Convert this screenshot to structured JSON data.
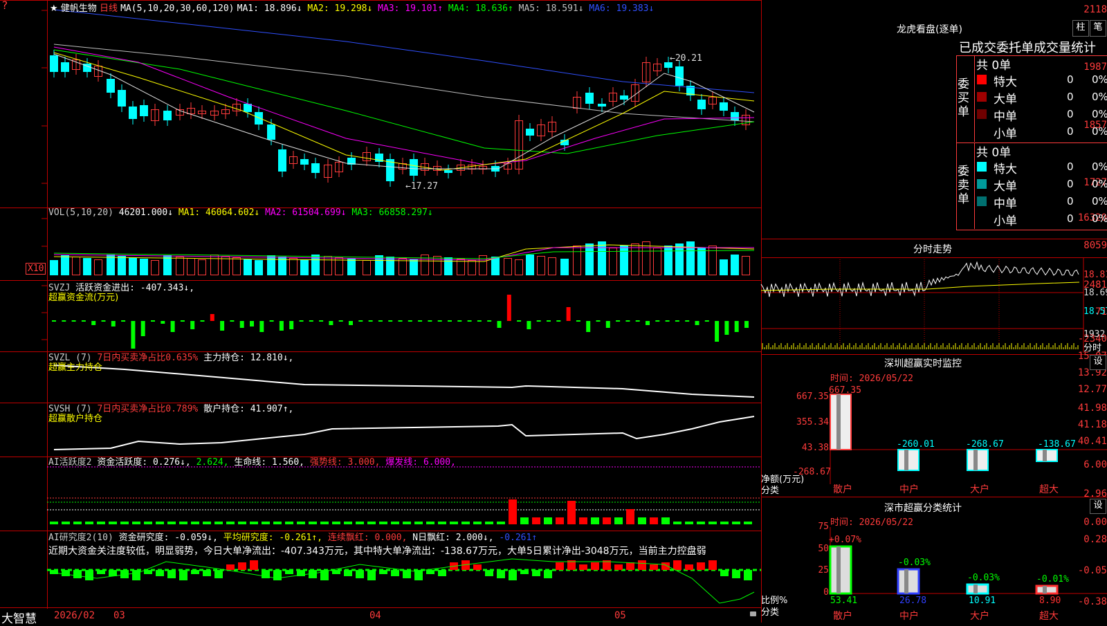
{
  "main": {
    "stock_name": "健帆生物",
    "period": "日线",
    "ma_header": "MA(5,10,20,30,60,120)",
    "ma_items": [
      {
        "label": "MA1: 18.896↓",
        "color": "#ffffff"
      },
      {
        "label": "MA2: 19.298↓",
        "color": "#ffff00"
      },
      {
        "label": "MA3: 19.101↑",
        "color": "#ff00ff"
      },
      {
        "label": "MA4: 18.636↑",
        "color": "#00ff00"
      },
      {
        "label": "MA5: 18.591↓",
        "color": "#c0c0c0"
      },
      {
        "label": "MA6: 19.383↓",
        "color": "#3050ff"
      }
    ],
    "y_labels": [
      "2118",
      "1987",
      "1857",
      "1727"
    ],
    "high_mark": "20.21",
    "low_mark": "17.27",
    "marker": "★"
  },
  "vol": {
    "title": "VOL(5,10,20)",
    "value": "46201.000↓",
    "items": [
      {
        "label": "MA1: 46064.602↓",
        "color": "#ffff00"
      },
      {
        "label": "MA2: 61504.699↓",
        "color": "#ff00ff"
      },
      {
        "label": "MA3: 66858.297↓",
        "color": "#00ff00"
      }
    ],
    "y_labels": [
      "16320",
      "8059"
    ],
    "unit": "X10"
  },
  "svzj": {
    "title": "SVZJ",
    "text": "活跃资金进出: -407.343↓,",
    "sub": "超赢资金流(万元)",
    "y_labels": [
      "2481",
      "71",
      "-2340"
    ]
  },
  "svzl": {
    "title": "SVZL (7)",
    "red_text": "7日内买卖净占比0.635%",
    "text": "主力持仓: 12.810↓,",
    "sub": "超赢主力持仓",
    "y_labels": [
      "15.07",
      "13.92",
      "12.77"
    ]
  },
  "svsh": {
    "title": "SVSH (7)",
    "red_text": "7日内买卖净占比0.789%",
    "text": "散户持仓: 41.907↑,",
    "sub": "超赢散户持仓",
    "y_labels": [
      "41.98",
      "41.18",
      "40.41"
    ]
  },
  "ai1": {
    "title": "AI活跃度2",
    "items": [
      {
        "label": "资金活跃度: 0.276↓,",
        "color": "#ffffff"
      },
      {
        "label": "2.624,",
        "color": "#00ff00"
      },
      {
        "label": "生命线: 1.560,",
        "color": "#ffffff"
      },
      {
        "label": "强势线: 3.000,",
        "color": "#ff3b3b"
      },
      {
        "label": "爆发线: 6.000,",
        "color": "#ff00ff"
      }
    ],
    "y_labels": [
      "6.00",
      "2.96",
      "0.00"
    ]
  },
  "ai2": {
    "title": "AI研究度2(10)",
    "items": [
      {
        "label": "资金研究度: -0.059↓,",
        "color": "#ffffff"
      },
      {
        "label": "平均研究度: -0.261↑,",
        "color": "#ffff00"
      },
      {
        "label": "连续飘红: 0.000,",
        "color": "#ff3b3b"
      },
      {
        "label": "N日飘红: 2.000↓,",
        "color": "#ffffff"
      },
      {
        "label": "-0.261↑",
        "color": "#3050ff"
      }
    ],
    "comment": "近期大资金关注度较低，明显弱势，今日大单净流出：-407.343万元，其中特大单净流出：-138.67万元，大单5日累计净出-3048万元，当前主力控盘弱",
    "y_labels": [
      "0.28",
      "-0.05",
      "-0.38"
    ]
  },
  "axis": {
    "brand": "大智慧",
    "labels": [
      "2026/02",
      "03",
      "04",
      "05"
    ]
  },
  "longhu": {
    "title": "龙虎看盘(逐单)",
    "btn_zhu": "柱",
    "btn_bi": "笔",
    "header": "已成交委托单成交量统计",
    "buy_label": "委买单",
    "sell_label": "委卖单",
    "buy_total": "共 0单",
    "sell_total": "共 0单",
    "buy_rows": [
      {
        "name": "特大",
        "count": "0",
        "pct": "0%",
        "color": "#ff0000"
      },
      {
        "name": "大单",
        "count": "0",
        "pct": "0%",
        "color": "#a00000"
      },
      {
        "name": "中单",
        "count": "0",
        "pct": "0%",
        "color": "#700000"
      },
      {
        "name": "小单",
        "count": "0",
        "pct": "0%",
        "color": ""
      }
    ],
    "sell_rows": [
      {
        "name": "特大",
        "count": "0",
        "pct": "0%",
        "color": "#00ffff"
      },
      {
        "name": "大单",
        "count": "0",
        "pct": "0%",
        "color": "#009a9a"
      },
      {
        "name": "中单",
        "count": "0",
        "pct": "0%",
        "color": "#007070"
      },
      {
        "name": "小单",
        "count": "0",
        "pct": "0%",
        "color": ""
      }
    ]
  },
  "fenshi": {
    "title": "分时走势",
    "y_labels": [
      "18.81",
      "18.69",
      "18.57"
    ],
    "vol_label": "1932",
    "corner": "分时"
  },
  "monitor": {
    "title": "深圳超赢实时监控",
    "btn": "设",
    "time": "时间: 2026/05/22",
    "y_labels": [
      "667.35",
      "355.34",
      "43.38",
      "-268.67"
    ],
    "ylabel_1": "净额(万元)",
    "ylabel_2": "分类",
    "bars": [
      {
        "cat": "散户",
        "value": "667.35"
      },
      {
        "cat": "中户",
        "value": "-260.01"
      },
      {
        "cat": "大户",
        "value": "-268.67"
      },
      {
        "cat": "超大",
        "value": "-138.67"
      }
    ]
  },
  "classify": {
    "title": "深市超赢分类统计",
    "btn": "设",
    "time": "时间: 2026/05/22",
    "y_labels": [
      "75",
      "50",
      "25",
      "0"
    ],
    "ylabel_1": "比例%",
    "ylabel_2": "分类",
    "bars": [
      {
        "cat": "散户",
        "change": "+0.07%",
        "value": "53.41",
        "color": "#00ff00"
      },
      {
        "cat": "中户",
        "change": "-0.03%",
        "value": "26.78",
        "color": "#3040ff"
      },
      {
        "cat": "大户",
        "change": "-0.03%",
        "value": "10.91",
        "color": "#00ffff"
      },
      {
        "cat": "超大",
        "change": "-0.01%",
        "value": "8.90",
        "color": "#ff3030"
      }
    ]
  }
}
